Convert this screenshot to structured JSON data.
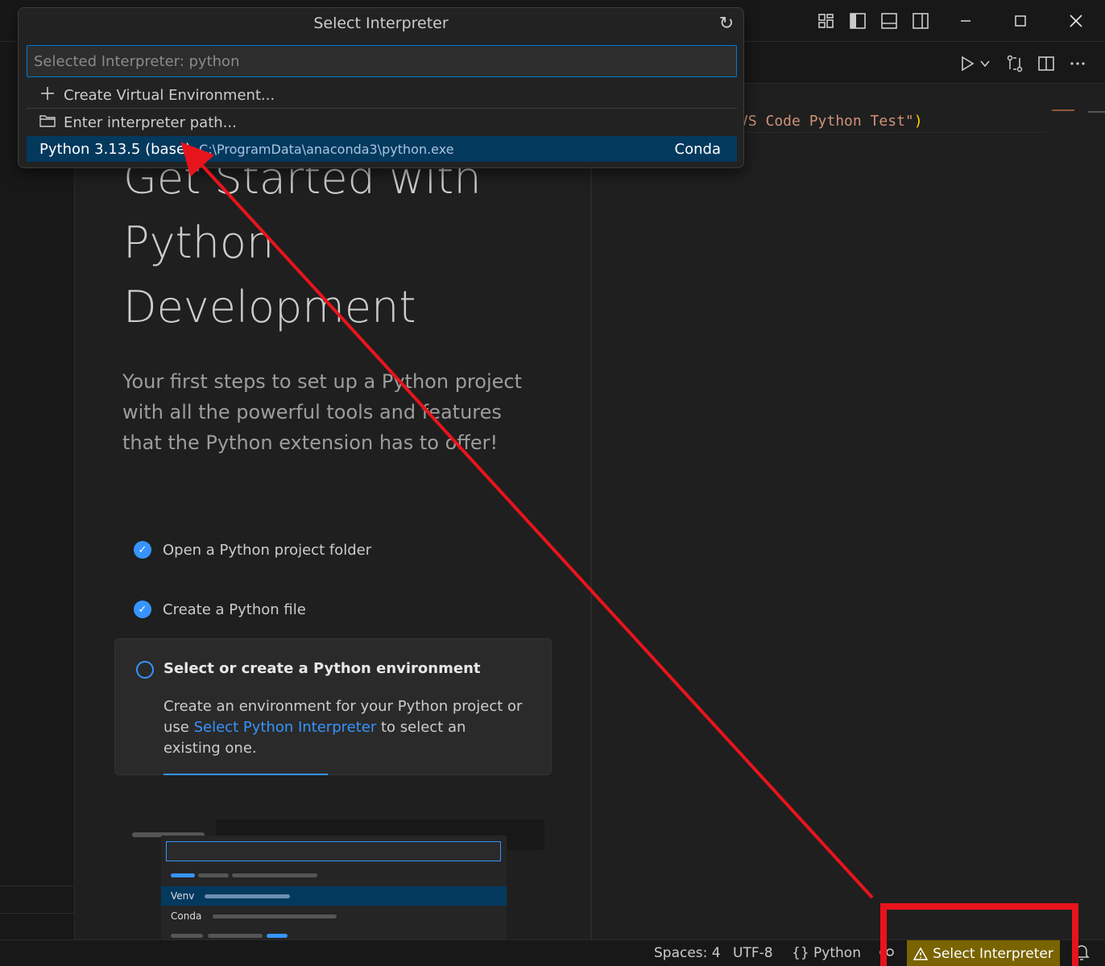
{
  "quick_pick": {
    "title": "Select Interpreter",
    "input_placeholder": "Selected Interpreter: python",
    "items": [
      {
        "label": "Create Virtual Environment...",
        "icon": "plus-icon"
      },
      {
        "label": "Enter interpreter path...",
        "icon": "folder-icon"
      },
      {
        "label": "Python 3.13.5 (base)",
        "description": "C:\\ProgramData\\anaconda3\\python.exe",
        "detail": "Conda",
        "selected": true
      }
    ]
  },
  "welcome": {
    "title_lines": [
      "Get Started with",
      "Python",
      "Development"
    ],
    "subtitle_lines": [
      "Your first steps to set up a Python project",
      "with all the powerful tools and features",
      "that the Python extension has to offer!"
    ],
    "steps": [
      {
        "label": "Open a Python project folder",
        "done": true
      },
      {
        "label": "Create a Python file",
        "done": true
      }
    ],
    "active_step": {
      "title": "Select or create a Python environment",
      "body_before": "Create an environment for your Python project or use ",
      "link": "Select Python Interpreter",
      "body_after": " to select an existing one."
    },
    "illustration": {
      "rows": [
        "Venv",
        "Conda"
      ]
    }
  },
  "editor": {
    "code_text": "VS Code Python Test\"",
    "code_paren": ")"
  },
  "status_bar": {
    "spaces": "Spaces: 4",
    "encoding": "UTF-8",
    "language_braces": "{}",
    "language": "Python",
    "interpreter_warning": "Select Interpreter"
  },
  "colors": {
    "accent": "#3794ff",
    "selection": "#04395e",
    "warning_bg": "#7a6400",
    "annotation": "#e8141c"
  }
}
